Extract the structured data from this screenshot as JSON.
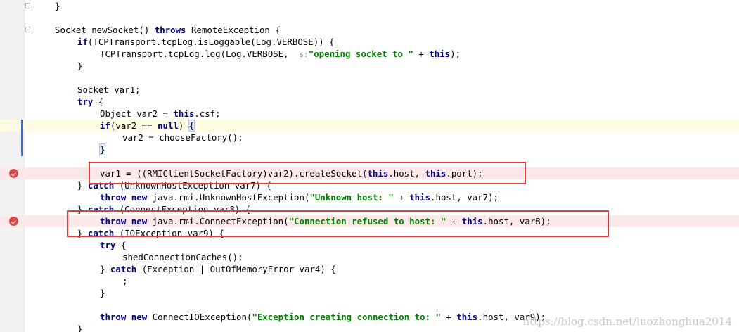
{
  "editor": {
    "watermark": "https://blog.csdn.net/luozhonghua2014",
    "colors": {
      "keyword": "#000080",
      "string": "#008000",
      "hint": "#888888",
      "current_line_bg": "#fdfbe4",
      "breakpoint_line_bg": "#fbe8e8",
      "breakpoint_icon": "#d84a4a",
      "highlight_box": "#e03c3c",
      "change_bar": "#3a6cc9"
    },
    "icons": {
      "breakpoint": "breakpoint-icon",
      "fold": "fold-icon"
    },
    "lines": [
      {
        "indent": 0,
        "tokens": [
          {
            "t": "}"
          }
        ],
        "fold": "end"
      },
      {
        "indent": 0,
        "tokens": []
      },
      {
        "indent": 0,
        "fold": "start",
        "tokens": [
          {
            "t": "Socket newSocket() "
          },
          {
            "t": "throws",
            "c": "kw"
          },
          {
            "t": " RemoteException {"
          }
        ]
      },
      {
        "indent": 1,
        "tokens": [
          {
            "t": "if",
            "c": "kw"
          },
          {
            "t": "(TCPTransport.tcpLog.isLoggable(Log.VERBOSE)) {"
          }
        ]
      },
      {
        "indent": 2,
        "tokens": [
          {
            "t": "TCPTransport.tcpLog.log(Log.VERBOSE,  "
          },
          {
            "t": "s:",
            "c": "hint"
          },
          {
            "t": "\"opening socket to \"",
            "c": "str"
          },
          {
            "t": " + "
          },
          {
            "t": "this",
            "c": "kw"
          },
          {
            "t": ");"
          }
        ]
      },
      {
        "indent": 1,
        "tokens": [
          {
            "t": "}"
          }
        ]
      },
      {
        "indent": 0,
        "tokens": []
      },
      {
        "indent": 1,
        "tokens": [
          {
            "t": "Socket var1;"
          }
        ]
      },
      {
        "indent": 1,
        "tokens": [
          {
            "t": "try",
            "c": "kw"
          },
          {
            "t": " {"
          }
        ]
      },
      {
        "indent": 2,
        "tokens": [
          {
            "t": "Object var2 = "
          },
          {
            "t": "this",
            "c": "kw"
          },
          {
            "t": ".csf;"
          }
        ]
      },
      {
        "indent": 2,
        "current": true,
        "tokens": [
          {
            "t": "if",
            "c": "kw"
          },
          {
            "t": "(var2 == "
          },
          {
            "t": "null",
            "c": "kw"
          },
          {
            "t": ") "
          },
          {
            "t": "{",
            "c": "hl"
          }
        ]
      },
      {
        "indent": 3,
        "tokens": [
          {
            "t": "var2 = chooseFactory();"
          }
        ]
      },
      {
        "indent": 2,
        "tokens": [
          {
            "t": "}",
            "c": "hl"
          }
        ]
      },
      {
        "indent": 0,
        "tokens": []
      },
      {
        "indent": 2,
        "breakpoint": true,
        "tokens": [
          {
            "t": "var1 = ((RMIClientSocketFactory)var2).createSocket("
          },
          {
            "t": "this",
            "c": "kw"
          },
          {
            "t": ".host, "
          },
          {
            "t": "this",
            "c": "kw"
          },
          {
            "t": ".port);"
          }
        ]
      },
      {
        "indent": 1,
        "tokens": [
          {
            "t": "} "
          },
          {
            "t": "catch",
            "c": "kw"
          },
          {
            "t": " (UnknownHostException var7) {"
          }
        ]
      },
      {
        "indent": 2,
        "tokens": [
          {
            "t": "throw",
            "c": "kw"
          },
          {
            "t": " "
          },
          {
            "t": "new",
            "c": "kw"
          },
          {
            "t": " java.rmi.UnknownHostException("
          },
          {
            "t": "\"Unknown host: \"",
            "c": "str"
          },
          {
            "t": " + "
          },
          {
            "t": "this",
            "c": "kw"
          },
          {
            "t": ".host, var7);"
          }
        ]
      },
      {
        "indent": 1,
        "tokens": [
          {
            "t": "} "
          },
          {
            "t": "catch",
            "c": "kw"
          },
          {
            "t": " (ConnectException var8) {"
          }
        ]
      },
      {
        "indent": 2,
        "breakpoint": true,
        "tokens": [
          {
            "t": "throw",
            "c": "kw"
          },
          {
            "t": " "
          },
          {
            "t": "new",
            "c": "kw"
          },
          {
            "t": " java.rmi.ConnectException("
          },
          {
            "t": "\"Connection refused to host: \"",
            "c": "str"
          },
          {
            "t": " + "
          },
          {
            "t": "this",
            "c": "kw"
          },
          {
            "t": ".host, var8);"
          }
        ]
      },
      {
        "indent": 1,
        "tokens": [
          {
            "t": "} "
          },
          {
            "t": "catch",
            "c": "kw"
          },
          {
            "t": " (IOException var9) {"
          }
        ]
      },
      {
        "indent": 2,
        "tokens": [
          {
            "t": "try",
            "c": "kw"
          },
          {
            "t": " {"
          }
        ]
      },
      {
        "indent": 3,
        "tokens": [
          {
            "t": "shedConnectionCaches();"
          }
        ]
      },
      {
        "indent": 2,
        "tokens": [
          {
            "t": "} "
          },
          {
            "t": "catch",
            "c": "kw"
          },
          {
            "t": " (Exception | OutOfMemoryError var4) {"
          }
        ]
      },
      {
        "indent": 3,
        "tokens": [
          {
            "t": ";"
          }
        ]
      },
      {
        "indent": 2,
        "tokens": [
          {
            "t": "}"
          }
        ]
      },
      {
        "indent": 0,
        "tokens": []
      },
      {
        "indent": 2,
        "tokens": [
          {
            "t": "throw",
            "c": "kw"
          },
          {
            "t": " "
          },
          {
            "t": "new",
            "c": "kw"
          },
          {
            "t": " ConnectIOException("
          },
          {
            "t": "\"Exception creating connection to: \"",
            "c": "str"
          },
          {
            "t": " + "
          },
          {
            "t": "this",
            "c": "kw"
          },
          {
            "t": ".host, var9);"
          }
        ]
      },
      {
        "indent": 1,
        "tokens": [
          {
            "t": "}"
          }
        ]
      }
    ]
  }
}
